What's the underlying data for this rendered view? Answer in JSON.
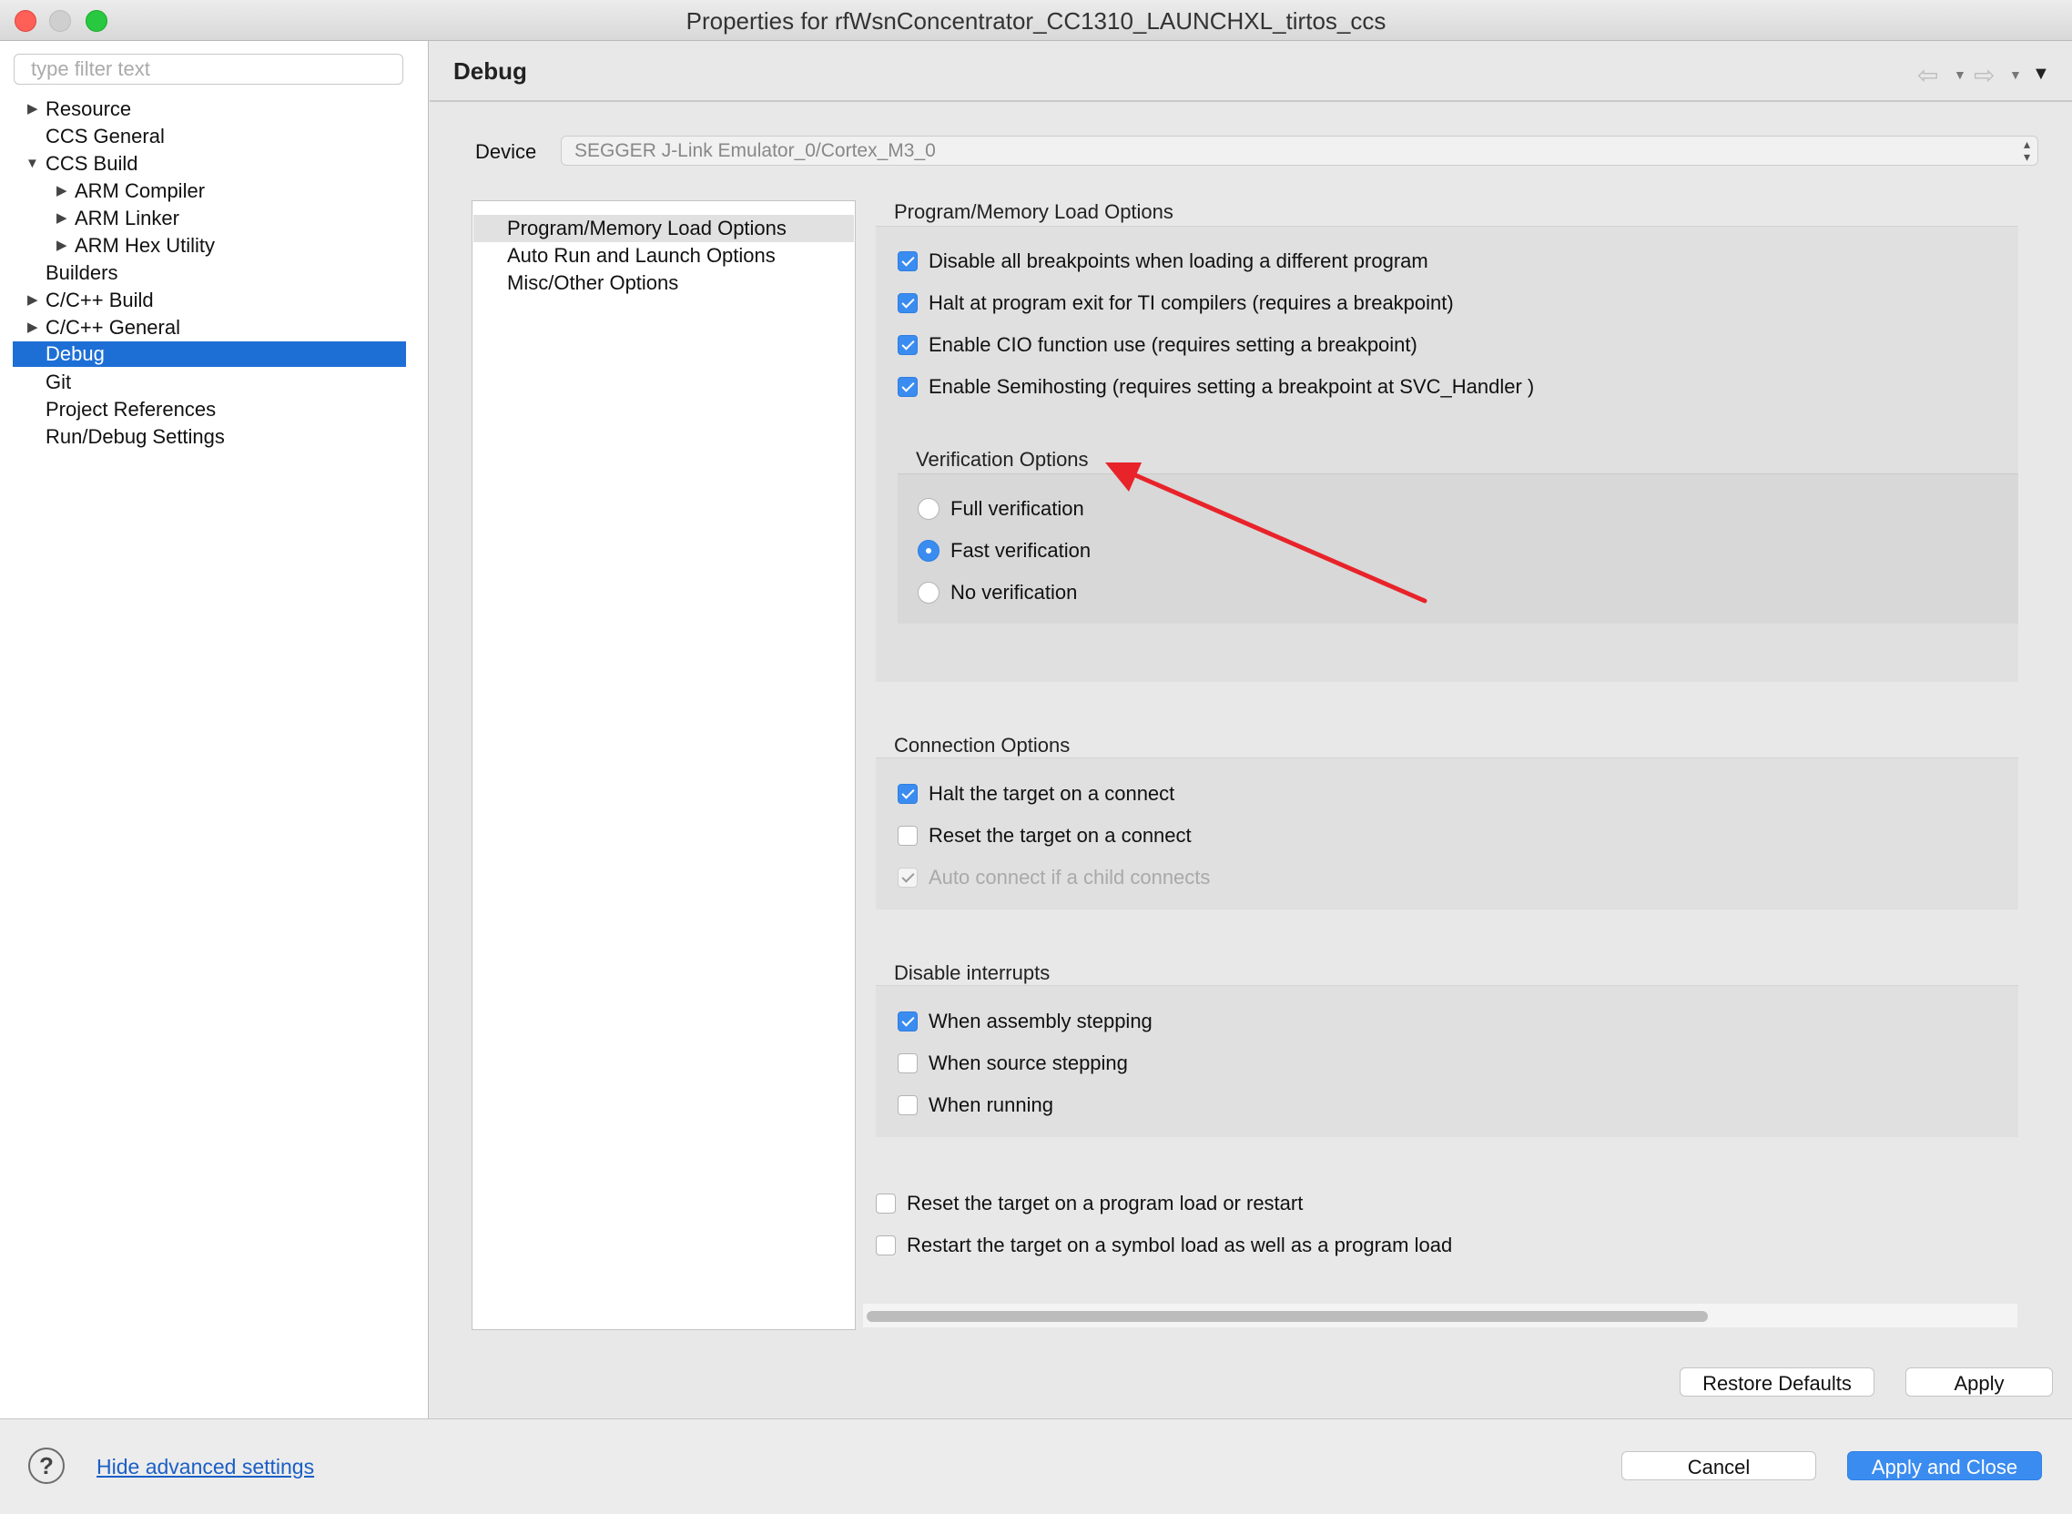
{
  "window": {
    "title": "Properties for rfWsnConcentrator_CC1310_LAUNCHXL_tirtos_ccs",
    "colors": {
      "close": "#fe5f57",
      "minimize": "#c8c8c8",
      "zoom": "#28c840",
      "accent": "#1d6fd6"
    }
  },
  "sidebar": {
    "filter_placeholder": "type filter text",
    "items": [
      {
        "label": "Resource",
        "expander": "collapsed"
      },
      {
        "label": "CCS General",
        "expander": "none"
      },
      {
        "label": "CCS Build",
        "expander": "expanded"
      },
      {
        "label": "ARM Compiler",
        "expander": "collapsed"
      },
      {
        "label": "ARM Linker",
        "expander": "collapsed"
      },
      {
        "label": "ARM Hex Utility",
        "expander": "collapsed"
      },
      {
        "label": "Builders",
        "expander": "none"
      },
      {
        "label": "C/C++ Build",
        "expander": "collapsed"
      },
      {
        "label": "C/C++ General",
        "expander": "collapsed"
      },
      {
        "label": "Debug",
        "expander": "none",
        "selected": true
      },
      {
        "label": "Git",
        "expander": "none"
      },
      {
        "label": "Project References",
        "expander": "none"
      },
      {
        "label": "Run/Debug Settings",
        "expander": "none"
      }
    ]
  },
  "page": {
    "title": "Debug",
    "nav_icons": [
      "back-arrow-icon",
      "forward-arrow-icon",
      "view-menu-icon"
    ]
  },
  "device": {
    "label": "Device",
    "value": "SEGGER J-Link Emulator_0/Cortex_M3_0"
  },
  "option_categories": [
    {
      "label": "Program/Memory Load Options",
      "selected": true
    },
    {
      "label": "Auto Run and Launch Options"
    },
    {
      "label": "Misc/Other Options"
    }
  ],
  "program_memory": {
    "title": "Program/Memory Load Options",
    "options": [
      {
        "label": "Disable all breakpoints when loading a different program",
        "checked": true
      },
      {
        "label": "Halt at program exit for TI compilers (requires a breakpoint)",
        "checked": true
      },
      {
        "label": "Enable CIO function use (requires setting a breakpoint)",
        "checked": true
      },
      {
        "label": "Enable Semihosting (requires setting a breakpoint at SVC_Handler )",
        "checked": true
      }
    ]
  },
  "verification": {
    "title": "Verification Options",
    "options": [
      {
        "label": "Full verification",
        "selected": false
      },
      {
        "label": "Fast verification",
        "selected": true
      },
      {
        "label": "No verification",
        "selected": false
      }
    ]
  },
  "connection": {
    "title": "Connection Options",
    "options": [
      {
        "label": "Halt the target on a connect",
        "checked": true
      },
      {
        "label": "Reset the target on a connect",
        "checked": false
      },
      {
        "label": "Auto connect if a child connects",
        "checked": true,
        "disabled": true
      }
    ]
  },
  "interrupts": {
    "title": "Disable interrupts",
    "options": [
      {
        "label": "When assembly stepping",
        "checked": true
      },
      {
        "label": "When source stepping",
        "checked": false
      },
      {
        "label": "When running",
        "checked": false
      }
    ]
  },
  "misc": {
    "options": [
      {
        "label": "Reset the target on a program load or restart",
        "checked": false
      },
      {
        "label": "Restart the target on a symbol load as well as a program load",
        "checked": false
      }
    ]
  },
  "buttons": {
    "restore_defaults": "Restore Defaults",
    "apply": "Apply",
    "cancel": "Cancel",
    "apply_close": "Apply and Close"
  },
  "footer": {
    "hide_advanced": "Hide advanced settings"
  },
  "annotation": {
    "color": "#e8232a",
    "points_to": "verification-options-title"
  }
}
